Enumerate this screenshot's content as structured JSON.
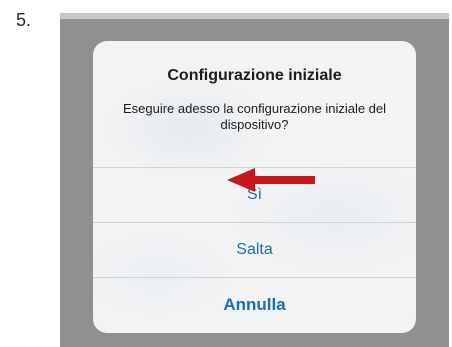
{
  "step": {
    "number": "5."
  },
  "dialog": {
    "title": "Configurazione iniziale",
    "message": "Eseguire adesso la configurazione iniziale del dispositivo?",
    "actions": [
      {
        "label": "Sì",
        "style": "default"
      },
      {
        "label": "Salta",
        "style": "default"
      },
      {
        "label": "Annulla",
        "style": "bold"
      }
    ]
  },
  "annotation": {
    "arrow_color": "#c8161d",
    "arrow_target": "Sì"
  },
  "colors": {
    "action_text": "#1a6fb0",
    "screen_background": "#8f9092",
    "dialog_background": "#f2f3f4"
  }
}
